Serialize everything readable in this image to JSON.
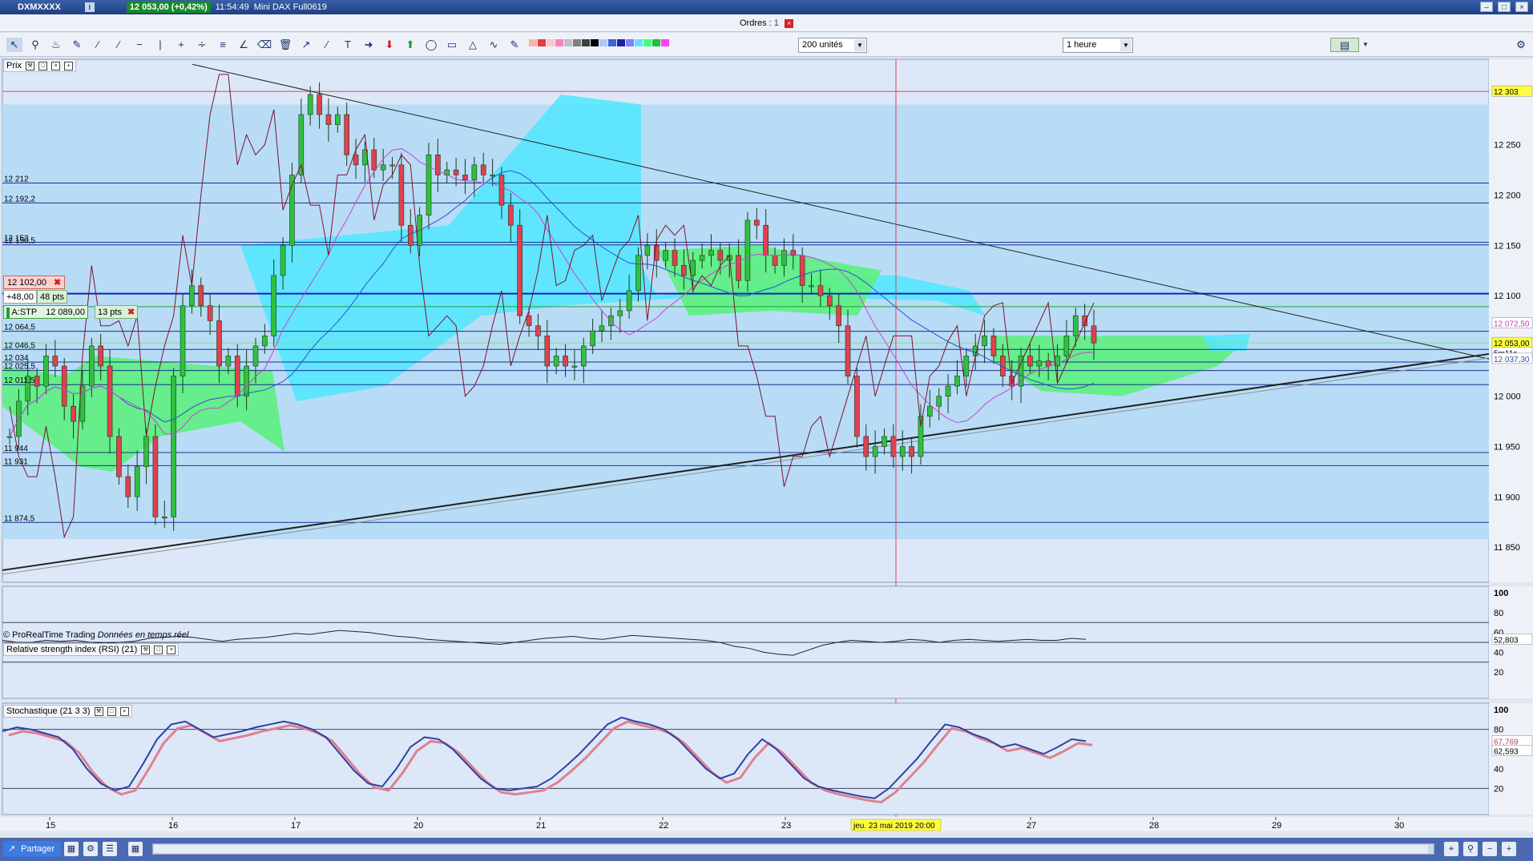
{
  "window": {
    "ticker": "DXMXXXX",
    "price_badge": "12 053,00 (+0,42%)",
    "time": "11:54:49",
    "instrument": "Mini DAX Full0619"
  },
  "orders_bar": {
    "label": "Ordres : ",
    "count": "1"
  },
  "toolbar": {
    "units_select": "200 unités",
    "timeframe_select": "1 heure",
    "swatch_colors": [
      "#ffb0b0",
      "#e04040",
      "#ffc8c8",
      "#ff80c0",
      "#c0c0c0",
      "#808080",
      "#404040",
      "#000000",
      "#b0c8ff",
      "#4060e0",
      "#2020a0",
      "#8080ff",
      "#60e0ff",
      "#40ff80",
      "#20c040",
      "#ff40ff"
    ]
  },
  "price_panel": {
    "label": "Prix",
    "copyright": "© ProRealTime Trading",
    "copyright_note": "Données en temps réel",
    "position_price": "12 102,00",
    "position_pnl": "+48,00",
    "position_pts": "48 pts",
    "stop_label": "A:STP",
    "stop_price": "12 089,00",
    "stop_pts": "13 pts",
    "left_levels": [
      {
        "label": "12 212",
        "price": 12212
      },
      {
        "label": "12 192,2",
        "price": 12192.2
      },
      {
        "label": "12 153",
        "price": 12153
      },
      {
        "label": "12 150,5",
        "price": 12150.5
      },
      {
        "label": "12 064,5",
        "price": 12064.5
      },
      {
        "label": "12 046,5",
        "price": 12046.5
      },
      {
        "label": "12 034",
        "price": 12034
      },
      {
        "label": "12 025,5",
        "price": 12025.5
      },
      {
        "label": "12 011,5",
        "price": 12011.5
      },
      {
        "label": "11 944",
        "price": 11944
      },
      {
        "label": "11 931",
        "price": 11931
      },
      {
        "label": "11 874,5",
        "price": 11874.5
      }
    ],
    "axis_ticks": [
      {
        "label": "12 250",
        "price": 12250
      },
      {
        "label": "12 200",
        "price": 12200
      },
      {
        "label": "12 150",
        "price": 12150
      },
      {
        "label": "12 100",
        "price": 12100
      },
      {
        "label": "12 000",
        "price": 12000
      },
      {
        "label": "11 950",
        "price": 11950
      },
      {
        "label": "11 900",
        "price": 11900
      },
      {
        "label": "11 850",
        "price": 11850
      }
    ],
    "axis_badges": [
      {
        "label": "12 303",
        "price": 12303,
        "bg": "#ffff40",
        "fg": "#000000"
      },
      {
        "label": "12 072,50",
        "price": 12072.5,
        "bg": "#ffffff",
        "fg": "#c040c0"
      },
      {
        "label": "12 053,00",
        "price": 12053,
        "bg": "#ffff40",
        "fg": "#000000"
      },
      {
        "label": "5m11s",
        "price": 12043,
        "bg": "#ffffff",
        "fg": "#000000"
      },
      {
        "label": "12 037,30",
        "price": 12037.3,
        "bg": "#ffffff",
        "fg": "#3050b0"
      }
    ]
  },
  "rsi_panel": {
    "label": "Relative strength index (RSI) (21)",
    "value": "52,803",
    "ticks": [
      "100",
      "80",
      "60",
      "40",
      "20"
    ]
  },
  "stoch_panel": {
    "label": "Stochastique (21 3 3)",
    "value_k": "67,769",
    "value_d": "62,593",
    "ticks": [
      "100",
      "80",
      "40",
      "20"
    ]
  },
  "time_axis": {
    "labels": [
      {
        "label": "15",
        "x": 62
      },
      {
        "label": "16",
        "x": 215
      },
      {
        "label": "17",
        "x": 368
      },
      {
        "label": "20",
        "x": 521
      },
      {
        "label": "21",
        "x": 674
      },
      {
        "label": "22",
        "x": 827
      },
      {
        "label": "23",
        "x": 980
      },
      {
        "label": "27",
        "x": 1286
      },
      {
        "label": "28",
        "x": 1439
      },
      {
        "label": "29",
        "x": 1592
      },
      {
        "label": "30",
        "x": 1745
      }
    ],
    "cursor_label": "jeu. 23 mai 2019 20:00"
  },
  "bottom_bar": {
    "share_label": "Partager"
  },
  "chart_data": {
    "type": "candlestick",
    "y_range": [
      11815,
      12335
    ],
    "series_close": [
      11960,
      11995,
      12020,
      12010,
      12040,
      12030,
      11990,
      11975,
      12010,
      12050,
      12030,
      11960,
      11920,
      11900,
      11930,
      11960,
      11880,
      11880,
      12020,
      12090,
      12110,
      12090,
      12075,
      12030,
      12040,
      12000,
      12030,
      12050,
      12060,
      12120,
      12150,
      12220,
      12280,
      12300,
      12280,
      12270,
      12280,
      12240,
      12230,
      12245,
      12225,
      12230,
      12230,
      12170,
      12150,
      12180,
      12240,
      12220,
      12225,
      12220,
      12215,
      12230,
      12220,
      12220,
      12190,
      12170,
      12080,
      12070,
      12060,
      12030,
      12040,
      12030,
      12030,
      12050,
      12065,
      12070,
      12080,
      12085,
      12105,
      12140,
      12150,
      12135,
      12145,
      12130,
      12120,
      12135,
      12140,
      12145,
      12135,
      12140,
      12115,
      12175,
      12170,
      12140,
      12130,
      12145,
      12140,
      12110,
      12110,
      12100,
      12090,
      12070,
      12020,
      11960,
      11940,
      11950,
      11960,
      11940,
      11950,
      11940,
      11980,
      11990,
      12000,
      12010,
      12020,
      12040,
      12050,
      12060,
      12040,
      12020,
      12010,
      12040,
      12030,
      12035,
      12030,
      12040,
      12060,
      12080,
      12070,
      12053
    ],
    "rsi": [
      52,
      50,
      50,
      52,
      51,
      52,
      50,
      49,
      50,
      51,
      54,
      55,
      56,
      55,
      53,
      51,
      53,
      54,
      55,
      57,
      59,
      58,
      60,
      62,
      61,
      60,
      58,
      56,
      55,
      53,
      52,
      51,
      50,
      49,
      48,
      50,
      52,
      54,
      55,
      56,
      54,
      53,
      55,
      57,
      56,
      55,
      54,
      53,
      52,
      50,
      46,
      44,
      40,
      38,
      37,
      42,
      47,
      50,
      52,
      51,
      50,
      51,
      53,
      52,
      50,
      52,
      53,
      52,
      51,
      52,
      53,
      52,
      52,
      54,
      53
    ],
    "stoch_k": [
      78,
      82,
      80,
      76,
      72,
      60,
      40,
      25,
      18,
      22,
      45,
      70,
      85,
      88,
      80,
      72,
      75,
      78,
      82,
      85,
      88,
      85,
      80,
      72,
      55,
      38,
      25,
      22,
      40,
      62,
      72,
      70,
      60,
      45,
      30,
      20,
      18,
      20,
      22,
      30,
      42,
      55,
      70,
      85,
      92,
      88,
      85,
      80,
      70,
      55,
      40,
      30,
      35,
      55,
      70,
      60,
      45,
      30,
      22,
      18,
      15,
      12,
      10,
      20,
      35,
      50,
      68,
      85,
      82,
      75,
      70,
      62,
      65,
      60,
      55,
      62,
      70,
      68
    ]
  }
}
